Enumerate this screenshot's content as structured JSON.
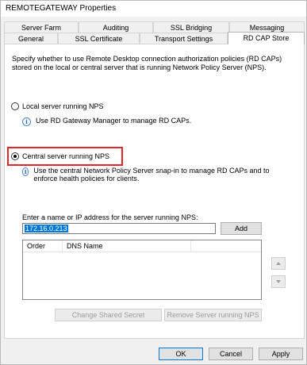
{
  "window": {
    "title": "REMOTEGATEWAY Properties"
  },
  "tabs_row1": [
    "Server Farm",
    "Auditing",
    "SSL Bridging",
    "Messaging"
  ],
  "tabs_row2": [
    "General",
    "SSL Certificate",
    "Transport Settings",
    "RD CAP Store"
  ],
  "active_tab": "RD CAP Store",
  "description": "Specify whether to use Remote Desktop connection authorization policies (RD CAPs) stored on the local or central server that is running Network Policy Server (NPS).",
  "local_option": {
    "label": "Local server running NPS",
    "info": "Use RD Gateway Manager to manage RD CAPs."
  },
  "central_option": {
    "label": "Central server running NPS",
    "info": "Use the central Network Policy Server snap-in to manage RD CAPs and to enforce health policies for clients."
  },
  "selected_option": "central",
  "server_entry": {
    "label": "Enter a name or IP address for the server running NPS:",
    "value": "172.16.0.213",
    "add_label": "Add"
  },
  "server_list": {
    "columns": [
      "Order",
      "DNS Name"
    ]
  },
  "buttons": {
    "change_secret": "Change Shared Secret",
    "remove_server": "Remove Server running NPS",
    "ok": "OK",
    "cancel": "Cancel",
    "apply": "Apply"
  },
  "colors": {
    "highlight": "#e0262b",
    "selection": "#0078d7"
  }
}
